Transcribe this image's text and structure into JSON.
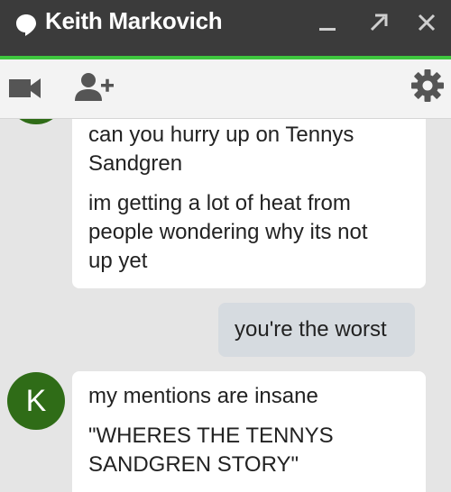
{
  "window": {
    "title": "Keith Markovich",
    "icons": {
      "chat": "speech-bubble-icon",
      "minimize": "minimize-icon",
      "popout": "popout-arrow-icon",
      "close": "close-icon"
    },
    "accent_color": "#3ec63e",
    "titlebar_color": "#3b3b3b"
  },
  "toolbar": {
    "icons": {
      "video": "video-camera-icon",
      "add_person": "add-person-icon",
      "settings": "gear-icon"
    }
  },
  "messages": [
    {
      "direction": "incoming",
      "lines": [
        "can you hurry up on Tennys",
        "Sandgren",
        "im getting a lot of heat from",
        "people wondering why its not",
        "up yet"
      ]
    },
    {
      "direction": "outgoing",
      "lines": [
        "you're the worst"
      ]
    },
    {
      "direction": "incoming",
      "avatar_initial": "K",
      "lines": [
        "my mentions are insane",
        "\"WHERES THE TENNYS",
        "SANDGREN STORY\""
      ]
    }
  ],
  "avatar_color": "#2f6c17"
}
